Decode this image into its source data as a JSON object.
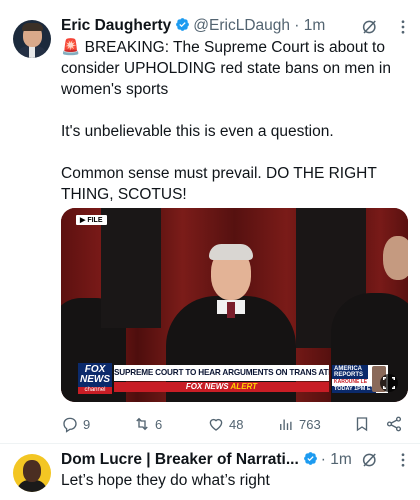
{
  "tweet": {
    "author_name": "Eric Daugherty",
    "handle": "@EricLDaugh",
    "time": "1m",
    "body": "🚨 BREAKING: The Supreme Court is about to consider UPHOLDING red state bans on men in women's sports\n\nIt's unbelievable this is even a question.\n\nCommon sense must prevail. DO THE RIGHT THING, SCOTUS!",
    "media": {
      "file_tag": "FILE",
      "chyron_main": "SUPREME COURT TO HEAR ARGUMENTS ON TRANS ATHLETES",
      "chyron_alert_prefix": "FOX NEWS",
      "chyron_alert_word": "ALERT",
      "logo_line1": "FOX",
      "logo_line2": "NEWS",
      "logo_line3": "channel",
      "side_title": "AMERICA REPORTS",
      "side_name": "KAROUNE LE",
      "side_time": "TODAY 1PM ET"
    },
    "actions": {
      "replies": "9",
      "reposts": "6",
      "likes": "48",
      "views": "763"
    }
  },
  "reply": {
    "author_name": "Dom Lucre | Breaker of Narrati...",
    "time": "1m",
    "body": "Let’s hope they do what’s right"
  },
  "colors": {
    "muted": "#536471",
    "verified": "#1d9bf0",
    "fox_red": "#c81d25",
    "fox_blue": "#0b2a6b"
  }
}
